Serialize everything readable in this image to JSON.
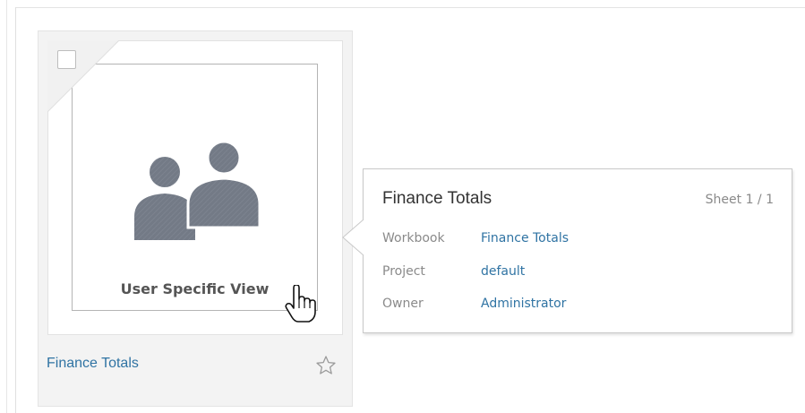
{
  "card": {
    "thumbnail_caption": "User Specific View",
    "title": "Finance Totals"
  },
  "tooltip": {
    "title": "Finance Totals",
    "sheet": "Sheet 1 / 1",
    "rows": [
      {
        "key": "Workbook",
        "value": "Finance Totals"
      },
      {
        "key": "Project",
        "value": "default"
      },
      {
        "key": "Owner",
        "value": "Administrator"
      }
    ]
  },
  "colors": {
    "link": "#2f73a3",
    "muted_label": "#8a8a8a",
    "icon_gray": "#6f7682"
  },
  "icons": {
    "thumbnail": "users-icon",
    "favorite": "star-outline-icon",
    "cursor": "hand-pointer-icon"
  }
}
